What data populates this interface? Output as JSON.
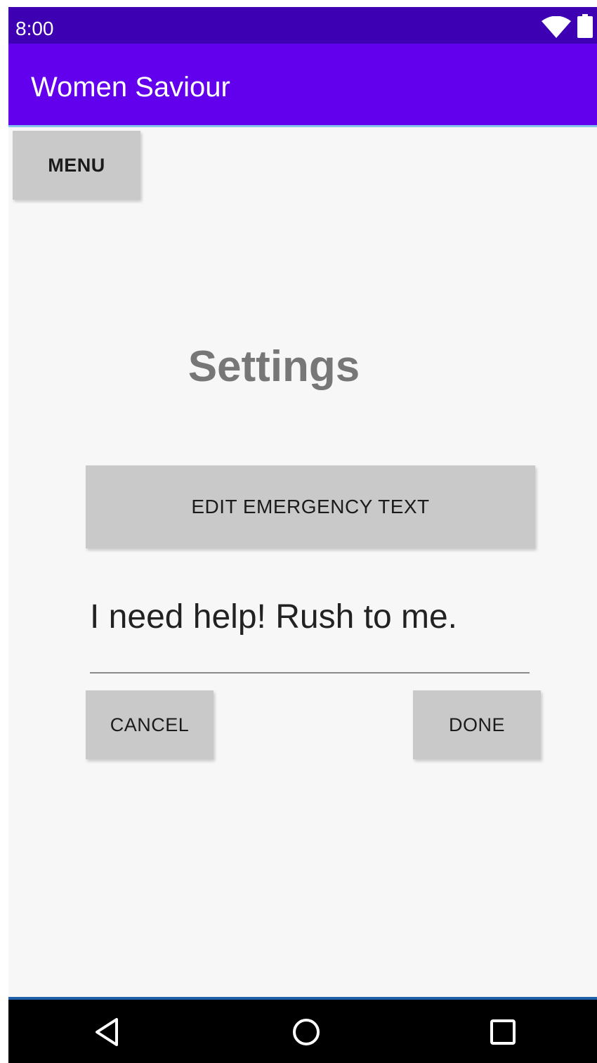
{
  "status_bar": {
    "time": "8:00",
    "icons": [
      "wifi-icon",
      "battery-icon"
    ]
  },
  "app_bar": {
    "title": "Women Saviour"
  },
  "colors": {
    "status_bar": "#3d00b3",
    "app_bar": "#6200ee",
    "background": "#f7f7f7",
    "button": "#c9c9c9",
    "title_text": "#777777"
  },
  "menu_button": {
    "label": "MENU"
  },
  "settings": {
    "title": "Settings",
    "edit_button_label": "EDIT EMERGENCY TEXT",
    "emergency_text_value": "I need help! Rush to me.",
    "cancel_label": "CANCEL",
    "done_label": "DONE"
  },
  "nav_bar": {
    "icons": [
      "back-icon",
      "home-icon",
      "recents-icon"
    ]
  }
}
